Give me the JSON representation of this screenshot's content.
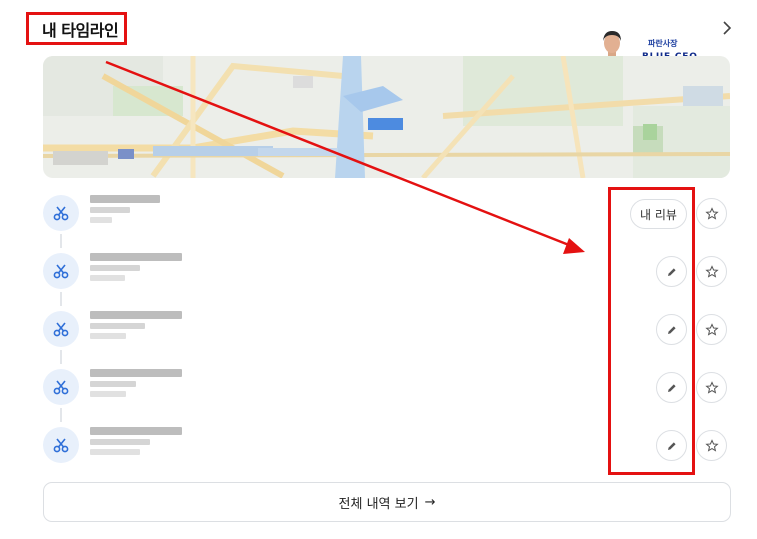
{
  "header": {
    "title": "내 타임라인",
    "more_icon": "chevron-right-icon"
  },
  "brand": {
    "name_ko": "파란사장",
    "name_en": "BLUE CEO"
  },
  "timeline": {
    "item_icon": "scissors-icon",
    "review_label": "내 리뷰",
    "edit_icon": "pencil-icon",
    "favorite_icon": "star-outline-icon",
    "items": [
      {
        "has_review": true
      },
      {
        "has_review": false
      },
      {
        "has_review": false
      },
      {
        "has_review": false
      },
      {
        "has_review": false
      }
    ]
  },
  "footer": {
    "view_all_label": "전체 내역 보기",
    "view_all_arrow": "→"
  },
  "colors": {
    "annotation_red": "#e41111",
    "accent_blue": "#2f6fd8",
    "icon_bg": "#e8f0fb"
  }
}
